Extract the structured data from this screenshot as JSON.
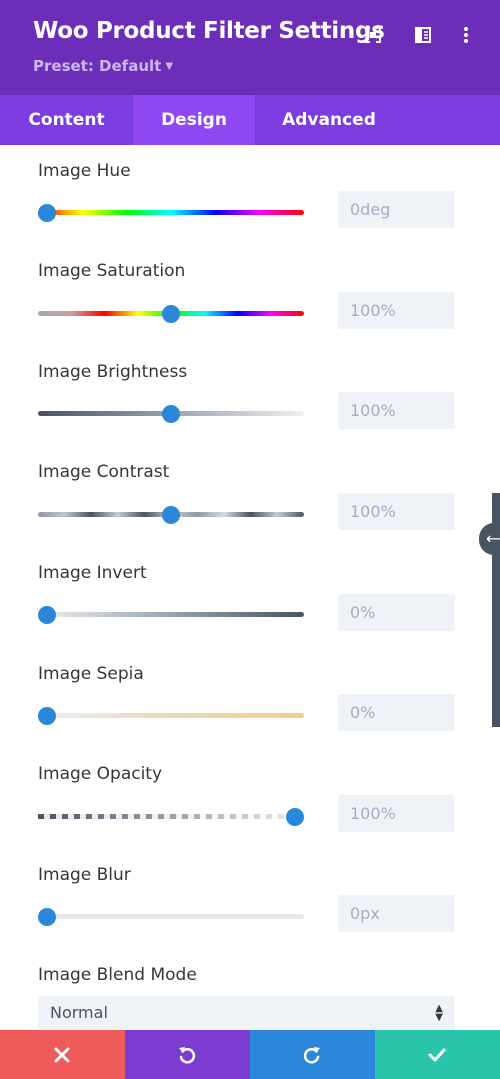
{
  "header": {
    "title": "Woo Product Filter Settings",
    "preset": "Preset: Default",
    "bg_color": "#6c2eb9",
    "icons": [
      "focus-icon",
      "sidebar-toggle-icon",
      "more-vertical-icon"
    ]
  },
  "tabs": [
    {
      "label": "Content",
      "active": false
    },
    {
      "label": "Design",
      "active": true
    },
    {
      "label": "Advanced",
      "active": false
    }
  ],
  "settings": [
    {
      "label": "Image Hue",
      "value": "0deg",
      "level": 0
    },
    {
      "label": "Image Saturation",
      "value": "100%",
      "level": 0.5
    },
    {
      "label": "Image Brightness",
      "value": "100%",
      "level": 0.5
    },
    {
      "label": "Image Contrast",
      "value": "100%",
      "level": 0.5
    },
    {
      "label": "Image Invert",
      "value": "0%",
      "level": 0
    },
    {
      "label": "Image Sepia",
      "value": "0%",
      "level": 0
    },
    {
      "label": "Image Opacity",
      "value": "100%",
      "level": 1
    },
    {
      "label": "Image Blur",
      "value": "0px",
      "level": 0
    }
  ],
  "blend_mode": {
    "label": "Image Blend Mode",
    "value": "Normal"
  },
  "footer": {
    "buttons": [
      {
        "name": "discard",
        "icon": "close-icon",
        "color": "#ef5b5b"
      },
      {
        "name": "undo",
        "icon": "undo-icon",
        "color": "#7e3bd0"
      },
      {
        "name": "redo",
        "icon": "redo-icon",
        "color": "#2b87da"
      },
      {
        "name": "save",
        "icon": "check-icon",
        "color": "#29c4a9"
      }
    ]
  },
  "colors": {
    "accent": "#2b87da",
    "tab_bar": "#7d3ce0",
    "tab_active": "#8f47f2"
  }
}
